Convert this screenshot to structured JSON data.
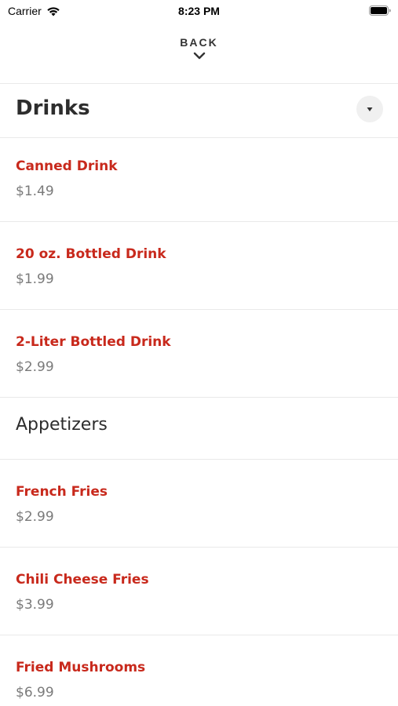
{
  "status": {
    "carrier": "Carrier",
    "time": "8:23 PM"
  },
  "nav": {
    "back_label": "BACK"
  },
  "sections": [
    {
      "title": "Drinks",
      "items": [
        {
          "name": "Canned Drink",
          "price": "$1.49"
        },
        {
          "name": "20 oz. Bottled Drink",
          "price": "$1.99"
        },
        {
          "name": "2-Liter Bottled Drink",
          "price": "$2.99"
        }
      ]
    },
    {
      "title": "Appetizers",
      "items": [
        {
          "name": "French Fries",
          "price": "$2.99"
        },
        {
          "name": "Chili Cheese Fries",
          "price": "$3.99"
        },
        {
          "name": "Fried Mushrooms",
          "price": "$6.99"
        }
      ]
    }
  ],
  "colors": {
    "item_name": "#c8291c",
    "price": "#7a7a7a"
  },
  "icons": {
    "wifi": "wifi-icon",
    "battery": "battery-icon",
    "back": "chevron-down-icon",
    "dropdown": "caret-down-icon"
  }
}
